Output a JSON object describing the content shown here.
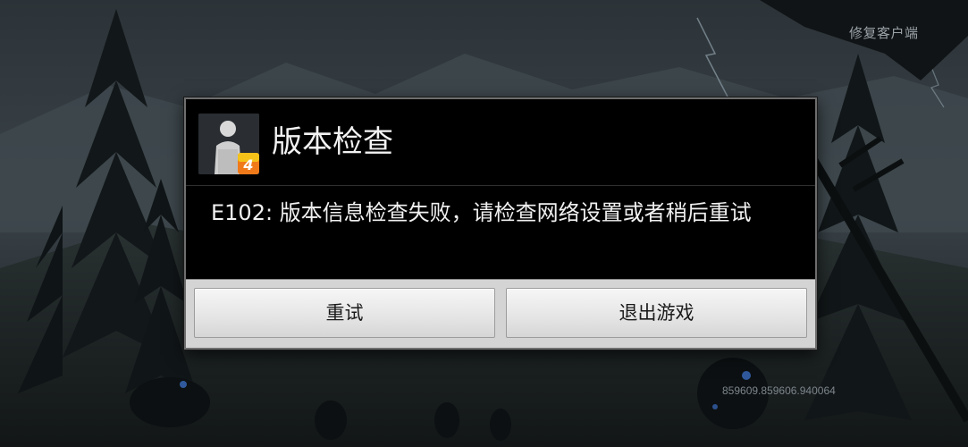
{
  "top_right": {
    "repair_label": "修复客户端"
  },
  "dialog": {
    "title": "版本检查",
    "message": "E102: 版本信息检查失败，请检查网络设置或者稍后重试",
    "buttons": {
      "retry": "重试",
      "exit": "退出游戏"
    },
    "icon_badge": "4"
  },
  "footer": {
    "version": "859609.859606.940064"
  },
  "colors": {
    "dialog_bg": "#000000",
    "dialog_border": "#6e6e6e",
    "button_bar_bg": "#d4d4d4",
    "badge_orange": "#f07a1a",
    "badge_yellow": "#f5c21a"
  },
  "icons": [
    "app-icon",
    "badge-icon"
  ]
}
